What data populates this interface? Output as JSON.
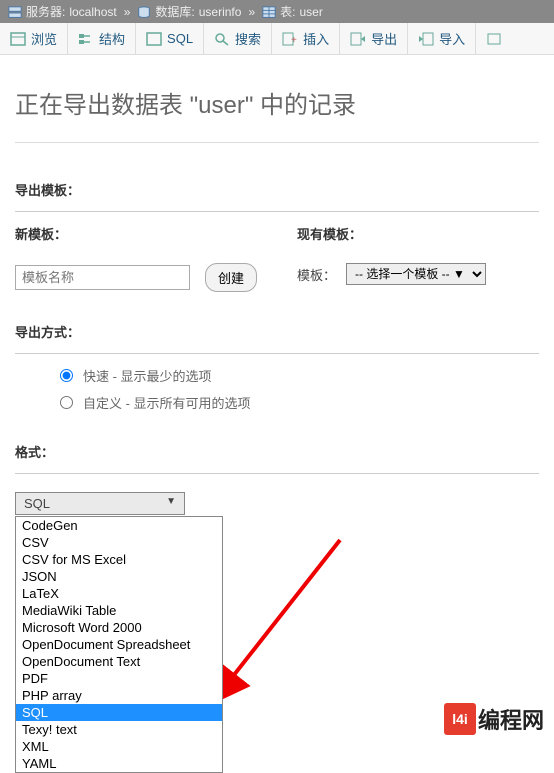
{
  "breadcrumb": {
    "server_label": "服务器:",
    "server_value": "localhost",
    "db_label": "数据库:",
    "db_value": "userinfo",
    "table_label": "表:",
    "table_value": "user"
  },
  "tabs": {
    "browse": "浏览",
    "structure": "结构",
    "sql": "SQL",
    "search": "搜索",
    "insert": "插入",
    "export": "导出",
    "import": "导入"
  },
  "title": "正在导出数据表 \"user\" 中的记录",
  "sections": {
    "export_template": "导出模板：",
    "new_template": "新模板：",
    "existing_template": "现有模板：",
    "template_label": "模板：",
    "export_method": "导出方式：",
    "format": "格式："
  },
  "inputs": {
    "template_name_placeholder": "模板名称",
    "create_btn": "创建",
    "select_template_placeholder": "-- 选择一个模板 -- ▼"
  },
  "radios": {
    "quick": "快速 - 显示最少的选项",
    "custom": "自定义 - 显示所有可用的选项"
  },
  "format_select": {
    "selected": "SQL",
    "options": [
      "CodeGen",
      "CSV",
      "CSV for MS Excel",
      "JSON",
      "LaTeX",
      "MediaWiki Table",
      "Microsoft Word 2000",
      "OpenDocument Spreadsheet",
      "OpenDocument Text",
      "PDF",
      "PHP array",
      "SQL",
      "Texy! text",
      "XML",
      "YAML"
    ]
  },
  "logo": {
    "box": "l4i",
    "text": "编程网"
  }
}
